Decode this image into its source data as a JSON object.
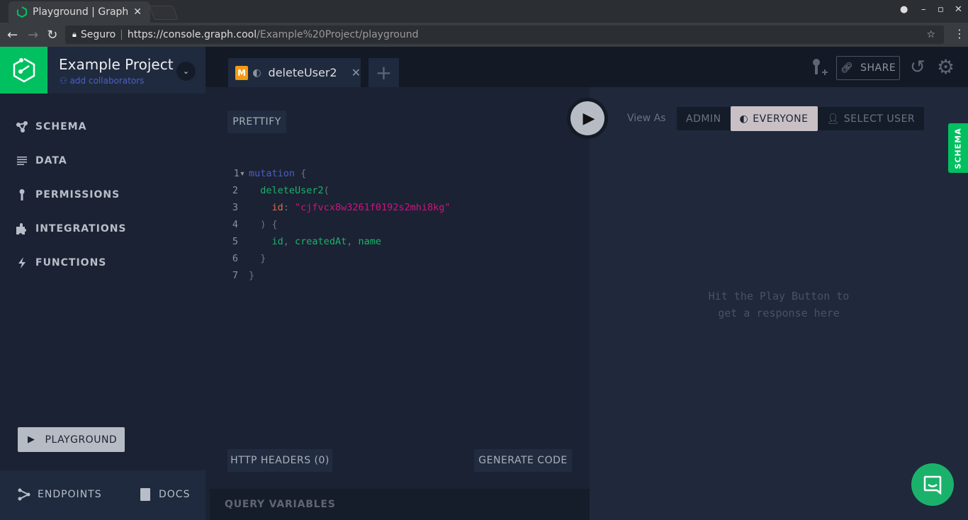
{
  "browser": {
    "tab_title": "Playground | Graph",
    "security": "Seguro",
    "url_host": "https://console.graph.cool",
    "url_path": "/Example%20Project/playground"
  },
  "sidebar": {
    "project_name": "Example Project",
    "add_collaborators": "add collaborators",
    "items": [
      {
        "label": "SCHEMA",
        "icon": "schema-icon"
      },
      {
        "label": "DATA",
        "icon": "list-icon"
      },
      {
        "label": "PERMISSIONS",
        "icon": "key-icon"
      },
      {
        "label": "INTEGRATIONS",
        "icon": "puzzle-icon"
      },
      {
        "label": "FUNCTIONS",
        "icon": "bolt-icon"
      }
    ],
    "playground": "PLAYGROUND",
    "endpoints": "ENDPOINTS",
    "docs": "DOCS"
  },
  "tabs": [
    {
      "badge": "M",
      "label": "deleteUser2"
    }
  ],
  "toolbar": {
    "share": "SHARE"
  },
  "editor": {
    "prettify": "PRETTIFY",
    "http_headers": "HTTP HEADERS (0)",
    "generate_code": "GENERATE CODE",
    "query_variables": "QUERY VARIABLES",
    "lines": [
      [
        [
          "kw",
          "mutation"
        ],
        [
          "pn",
          " {"
        ]
      ],
      [
        [
          "fld",
          "  deleteUser2"
        ],
        [
          "pn",
          "("
        ]
      ],
      [
        [
          "arg",
          "    id"
        ],
        [
          "pn",
          ": "
        ],
        [
          "str",
          "\"cjfvcx8w3261f0192s2mhi8kg\""
        ]
      ],
      [
        [
          "pn",
          "  ) {"
        ]
      ],
      [
        [
          "fld",
          "    id"
        ],
        [
          "pn",
          ", "
        ],
        [
          "fld",
          "createdAt"
        ],
        [
          "pn",
          ", "
        ],
        [
          "fld",
          "name"
        ]
      ],
      [
        [
          "pn",
          "  }"
        ]
      ],
      [
        [
          "pn",
          "}"
        ]
      ]
    ]
  },
  "view_as": {
    "label": "View As",
    "options": [
      "ADMIN",
      "EVERYONE",
      "SELECT USER"
    ],
    "selected": "EVERYONE"
  },
  "response": {
    "hint_line1": "Hit the Play Button to",
    "hint_line2": "get a response here"
  },
  "schema_tab": "SCHEMA",
  "colors": {
    "accent": "#00c060",
    "mutation_badge": "#f39c12"
  }
}
